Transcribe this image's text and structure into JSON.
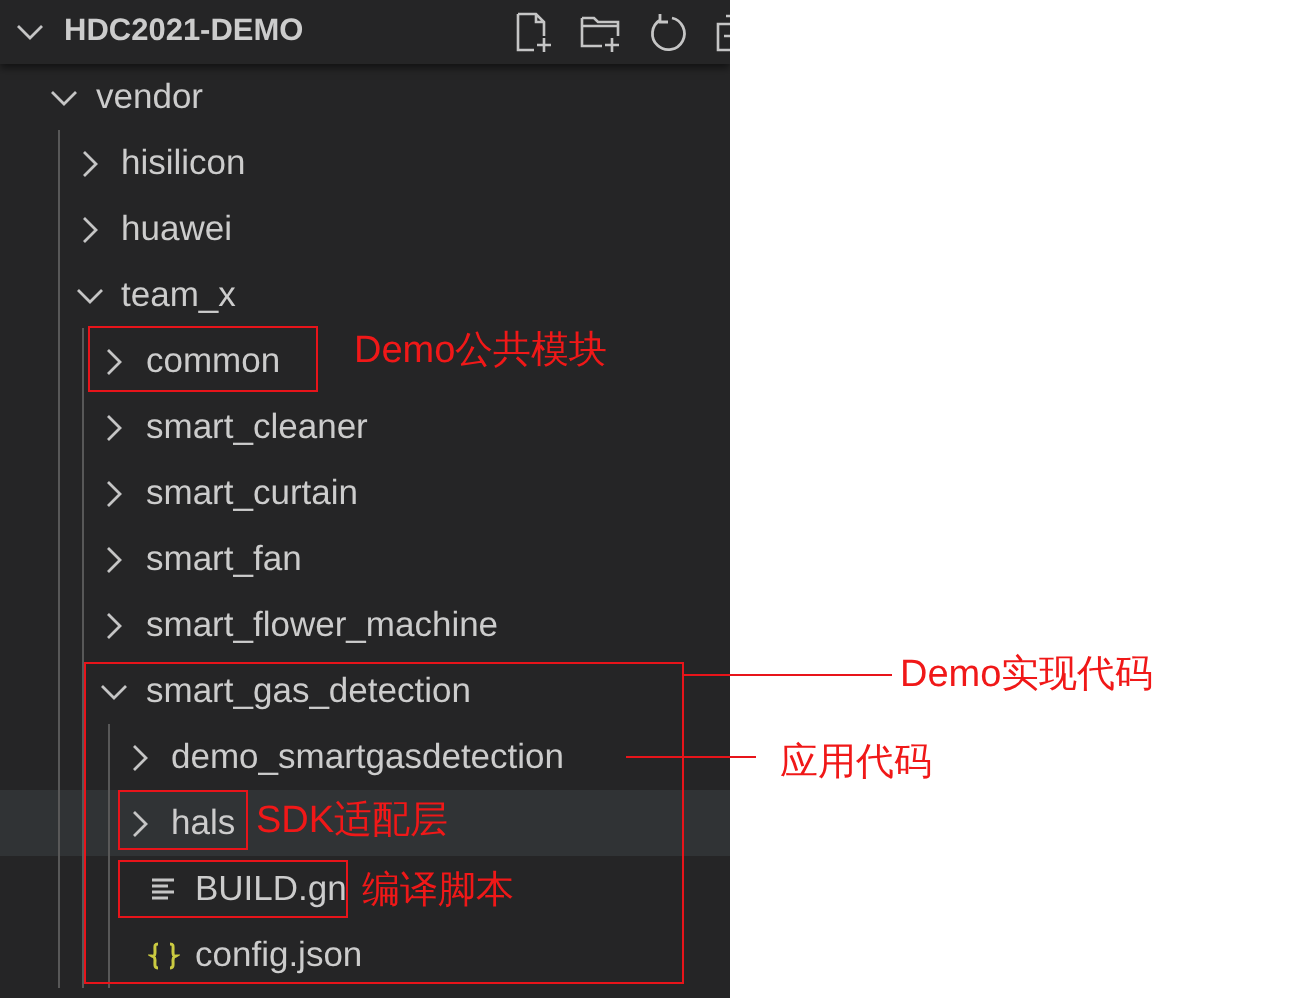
{
  "explorer": {
    "title": "HDC2021-DEMO",
    "expanded": true,
    "tree": [
      {
        "kind": "folder",
        "name": "vendor",
        "expanded": true,
        "hovered": false,
        "children": [
          {
            "kind": "folder",
            "name": "hisilicon",
            "expanded": false,
            "hovered": false
          },
          {
            "kind": "folder",
            "name": "huawei",
            "expanded": false,
            "hovered": false
          },
          {
            "kind": "folder",
            "name": "team_x",
            "expanded": true,
            "hovered": false,
            "children": [
              {
                "kind": "folder",
                "name": "common",
                "expanded": false,
                "hovered": false
              },
              {
                "kind": "folder",
                "name": "smart_cleaner",
                "expanded": false,
                "hovered": false
              },
              {
                "kind": "folder",
                "name": "smart_curtain",
                "expanded": false,
                "hovered": false
              },
              {
                "kind": "folder",
                "name": "smart_fan",
                "expanded": false,
                "hovered": false
              },
              {
                "kind": "folder",
                "name": "smart_flower_machine",
                "expanded": false,
                "hovered": false
              },
              {
                "kind": "folder",
                "name": "smart_gas_detection",
                "expanded": true,
                "hovered": false,
                "children": [
                  {
                    "kind": "folder",
                    "name": "demo_smartgasdetection",
                    "expanded": false,
                    "hovered": false
                  },
                  {
                    "kind": "folder",
                    "name": "hals",
                    "expanded": false,
                    "hovered": true
                  },
                  {
                    "kind": "text-file",
                    "name": "BUILD.gn",
                    "hovered": false
                  },
                  {
                    "kind": "json-file",
                    "name": "config.json",
                    "hovered": false
                  }
                ]
              }
            ]
          }
        ]
      }
    ]
  },
  "annotations": [
    {
      "label": "Demo公共模块"
    },
    {
      "label": "Demo实现代码"
    },
    {
      "label": "应用代码"
    },
    {
      "label": "SDK适配层"
    },
    {
      "label": "编译脚本"
    }
  ]
}
